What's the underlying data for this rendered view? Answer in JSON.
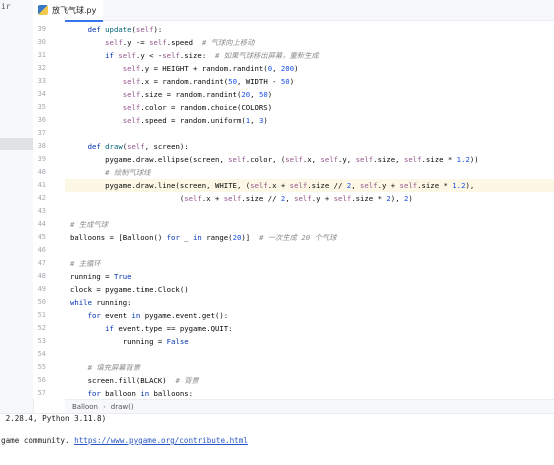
{
  "left_panel": {
    "label": "ir"
  },
  "tab": {
    "title": "放飞气球.py",
    "close": "×"
  },
  "breadcrumb": [
    "Balloon",
    "draw()"
  ],
  "editor": {
    "current_line": 41,
    "lines": [
      {
        "n": "39",
        "segs": [
          [
            "k",
            "    def "
          ],
          [
            "f",
            "update"
          ],
          [
            "t",
            "("
          ],
          [
            "s",
            "self"
          ],
          [
            "t",
            "):"
          ]
        ]
      },
      {
        "n": "30",
        "segs": [
          [
            "t",
            "        "
          ],
          [
            "s",
            "self"
          ],
          [
            "t",
            ".y -= "
          ],
          [
            "s",
            "self"
          ],
          [
            "t",
            ".speed  "
          ],
          [
            "c",
            "# 气球向上移动"
          ]
        ]
      },
      {
        "n": "31",
        "segs": [
          [
            "t",
            "        "
          ],
          [
            "k",
            "if "
          ],
          [
            "s",
            "self"
          ],
          [
            "t",
            ".y < -"
          ],
          [
            "s",
            "self"
          ],
          [
            "t",
            ".size:  "
          ],
          [
            "c",
            "# 如果气球移出屏幕，重新生成"
          ]
        ]
      },
      {
        "n": "32",
        "segs": [
          [
            "t",
            "            "
          ],
          [
            "s",
            "self"
          ],
          [
            "t",
            ".y = HEIGHT + random.randint("
          ],
          [
            "num",
            "0"
          ],
          [
            "t",
            ", "
          ],
          [
            "num",
            "200"
          ],
          [
            "t",
            ")"
          ]
        ]
      },
      {
        "n": "33",
        "segs": [
          [
            "t",
            "            "
          ],
          [
            "s",
            "self"
          ],
          [
            "t",
            ".x = random.randint("
          ],
          [
            "num",
            "50"
          ],
          [
            "t",
            ", WIDTH - "
          ],
          [
            "num",
            "50"
          ],
          [
            "t",
            ")"
          ]
        ]
      },
      {
        "n": "34",
        "segs": [
          [
            "t",
            "            "
          ],
          [
            "s",
            "self"
          ],
          [
            "t",
            ".size = random.randint("
          ],
          [
            "num",
            "20"
          ],
          [
            "t",
            ", "
          ],
          [
            "num",
            "50"
          ],
          [
            "t",
            ")"
          ]
        ]
      },
      {
        "n": "35",
        "segs": [
          [
            "t",
            "            "
          ],
          [
            "s",
            "self"
          ],
          [
            "t",
            ".color = random.choice(COLORS)"
          ]
        ]
      },
      {
        "n": "36",
        "segs": [
          [
            "t",
            "            "
          ],
          [
            "s",
            "self"
          ],
          [
            "t",
            ".speed = random.uniform("
          ],
          [
            "num",
            "1"
          ],
          [
            "t",
            ", "
          ],
          [
            "num",
            "3"
          ],
          [
            "t",
            ")"
          ]
        ]
      },
      {
        "n": "37",
        "segs": []
      },
      {
        "n": "38",
        "segs": [
          [
            "k",
            "    def "
          ],
          [
            "f",
            "draw"
          ],
          [
            "t",
            "("
          ],
          [
            "s",
            "self"
          ],
          [
            "t",
            ", screen):"
          ]
        ]
      },
      {
        "n": "39",
        "segs": [
          [
            "t",
            "        pygame.draw.ellipse(screen, "
          ],
          [
            "s",
            "self"
          ],
          [
            "t",
            ".color, ("
          ],
          [
            "s",
            "self"
          ],
          [
            "t",
            ".x, "
          ],
          [
            "s",
            "self"
          ],
          [
            "t",
            ".y, "
          ],
          [
            "s",
            "self"
          ],
          [
            "t",
            ".size, "
          ],
          [
            "s",
            "self"
          ],
          [
            "t",
            ".size * "
          ],
          [
            "num",
            "1.2"
          ],
          [
            "t",
            "))"
          ]
        ]
      },
      {
        "n": "40",
        "segs": [
          [
            "t",
            "        "
          ],
          [
            "c",
            "# 绘制气球线"
          ]
        ]
      },
      {
        "n": "41",
        "segs": [
          [
            "t",
            "        pygame.draw.line(screen, WHITE, ("
          ],
          [
            "s",
            "self"
          ],
          [
            "t",
            ".x + "
          ],
          [
            "s",
            "self"
          ],
          [
            "t",
            ".size // "
          ],
          [
            "num",
            "2"
          ],
          [
            "t",
            ", "
          ],
          [
            "s",
            "self"
          ],
          [
            "t",
            ".y + "
          ],
          [
            "s",
            "self"
          ],
          [
            "t",
            ".size * "
          ],
          [
            "num",
            "1.2"
          ],
          [
            "t",
            "),"
          ]
        ]
      },
      {
        "n": "42",
        "segs": [
          [
            "t",
            "                         ("
          ],
          [
            "s",
            "self"
          ],
          [
            "t",
            ".x + "
          ],
          [
            "s",
            "self"
          ],
          [
            "t",
            ".size // "
          ],
          [
            "num",
            "2"
          ],
          [
            "t",
            ", "
          ],
          [
            "s",
            "self"
          ],
          [
            "t",
            ".y + "
          ],
          [
            "s",
            "self"
          ],
          [
            "t",
            ".size * "
          ],
          [
            "num",
            "2"
          ],
          [
            "t",
            "), "
          ],
          [
            "num",
            "2"
          ],
          [
            "t",
            ")"
          ]
        ]
      },
      {
        "n": "43",
        "segs": []
      },
      {
        "n": "44",
        "segs": [
          [
            "c",
            "# 生成气球"
          ]
        ]
      },
      {
        "n": "45",
        "segs": [
          [
            "t",
            "balloons = [Balloon() "
          ],
          [
            "k",
            "for"
          ],
          [
            "t",
            " _ "
          ],
          [
            "k",
            "in"
          ],
          [
            "t",
            " range("
          ],
          [
            "num",
            "20"
          ],
          [
            "t",
            ")]  "
          ],
          [
            "c",
            "# 一次生成 20 个气球"
          ]
        ]
      },
      {
        "n": "46",
        "segs": []
      },
      {
        "n": "47",
        "segs": [
          [
            "c",
            "# 主循环"
          ]
        ]
      },
      {
        "n": "48",
        "segs": [
          [
            "t",
            "running = "
          ],
          [
            "k",
            "True"
          ]
        ]
      },
      {
        "n": "49",
        "segs": [
          [
            "t",
            "clock = pygame.time.Clock()"
          ]
        ]
      },
      {
        "n": "50",
        "segs": [
          [
            "k",
            "while"
          ],
          [
            "t",
            " running:"
          ]
        ]
      },
      {
        "n": "51",
        "segs": [
          [
            "t",
            "    "
          ],
          [
            "k",
            "for"
          ],
          [
            "t",
            " event "
          ],
          [
            "k",
            "in"
          ],
          [
            "t",
            " pygame.event.get():"
          ]
        ]
      },
      {
        "n": "52",
        "segs": [
          [
            "t",
            "        "
          ],
          [
            "k",
            "if"
          ],
          [
            "t",
            " event.type == pygame.QUIT:"
          ]
        ]
      },
      {
        "n": "53",
        "segs": [
          [
            "t",
            "            running = "
          ],
          [
            "k",
            "False"
          ]
        ]
      },
      {
        "n": "54",
        "segs": []
      },
      {
        "n": "55",
        "segs": [
          [
            "t",
            "    "
          ],
          [
            "c",
            "# 填充屏幕背景"
          ]
        ]
      },
      {
        "n": "56",
        "segs": [
          [
            "t",
            "    screen.fill(BLACK)  "
          ],
          [
            "c",
            "# 背景"
          ]
        ]
      },
      {
        "n": "57",
        "segs": [
          [
            "t",
            "    "
          ],
          [
            "k",
            "for"
          ],
          [
            "t",
            " balloon "
          ],
          [
            "k",
            "in"
          ],
          [
            "t",
            " balloons:"
          ]
        ]
      }
    ]
  },
  "console": {
    "line1": " 2.28.4, Python 3.11.8)",
    "line2_prefix": "game community. ",
    "line2_link": "https://www.pygame.org/contribute.html"
  }
}
